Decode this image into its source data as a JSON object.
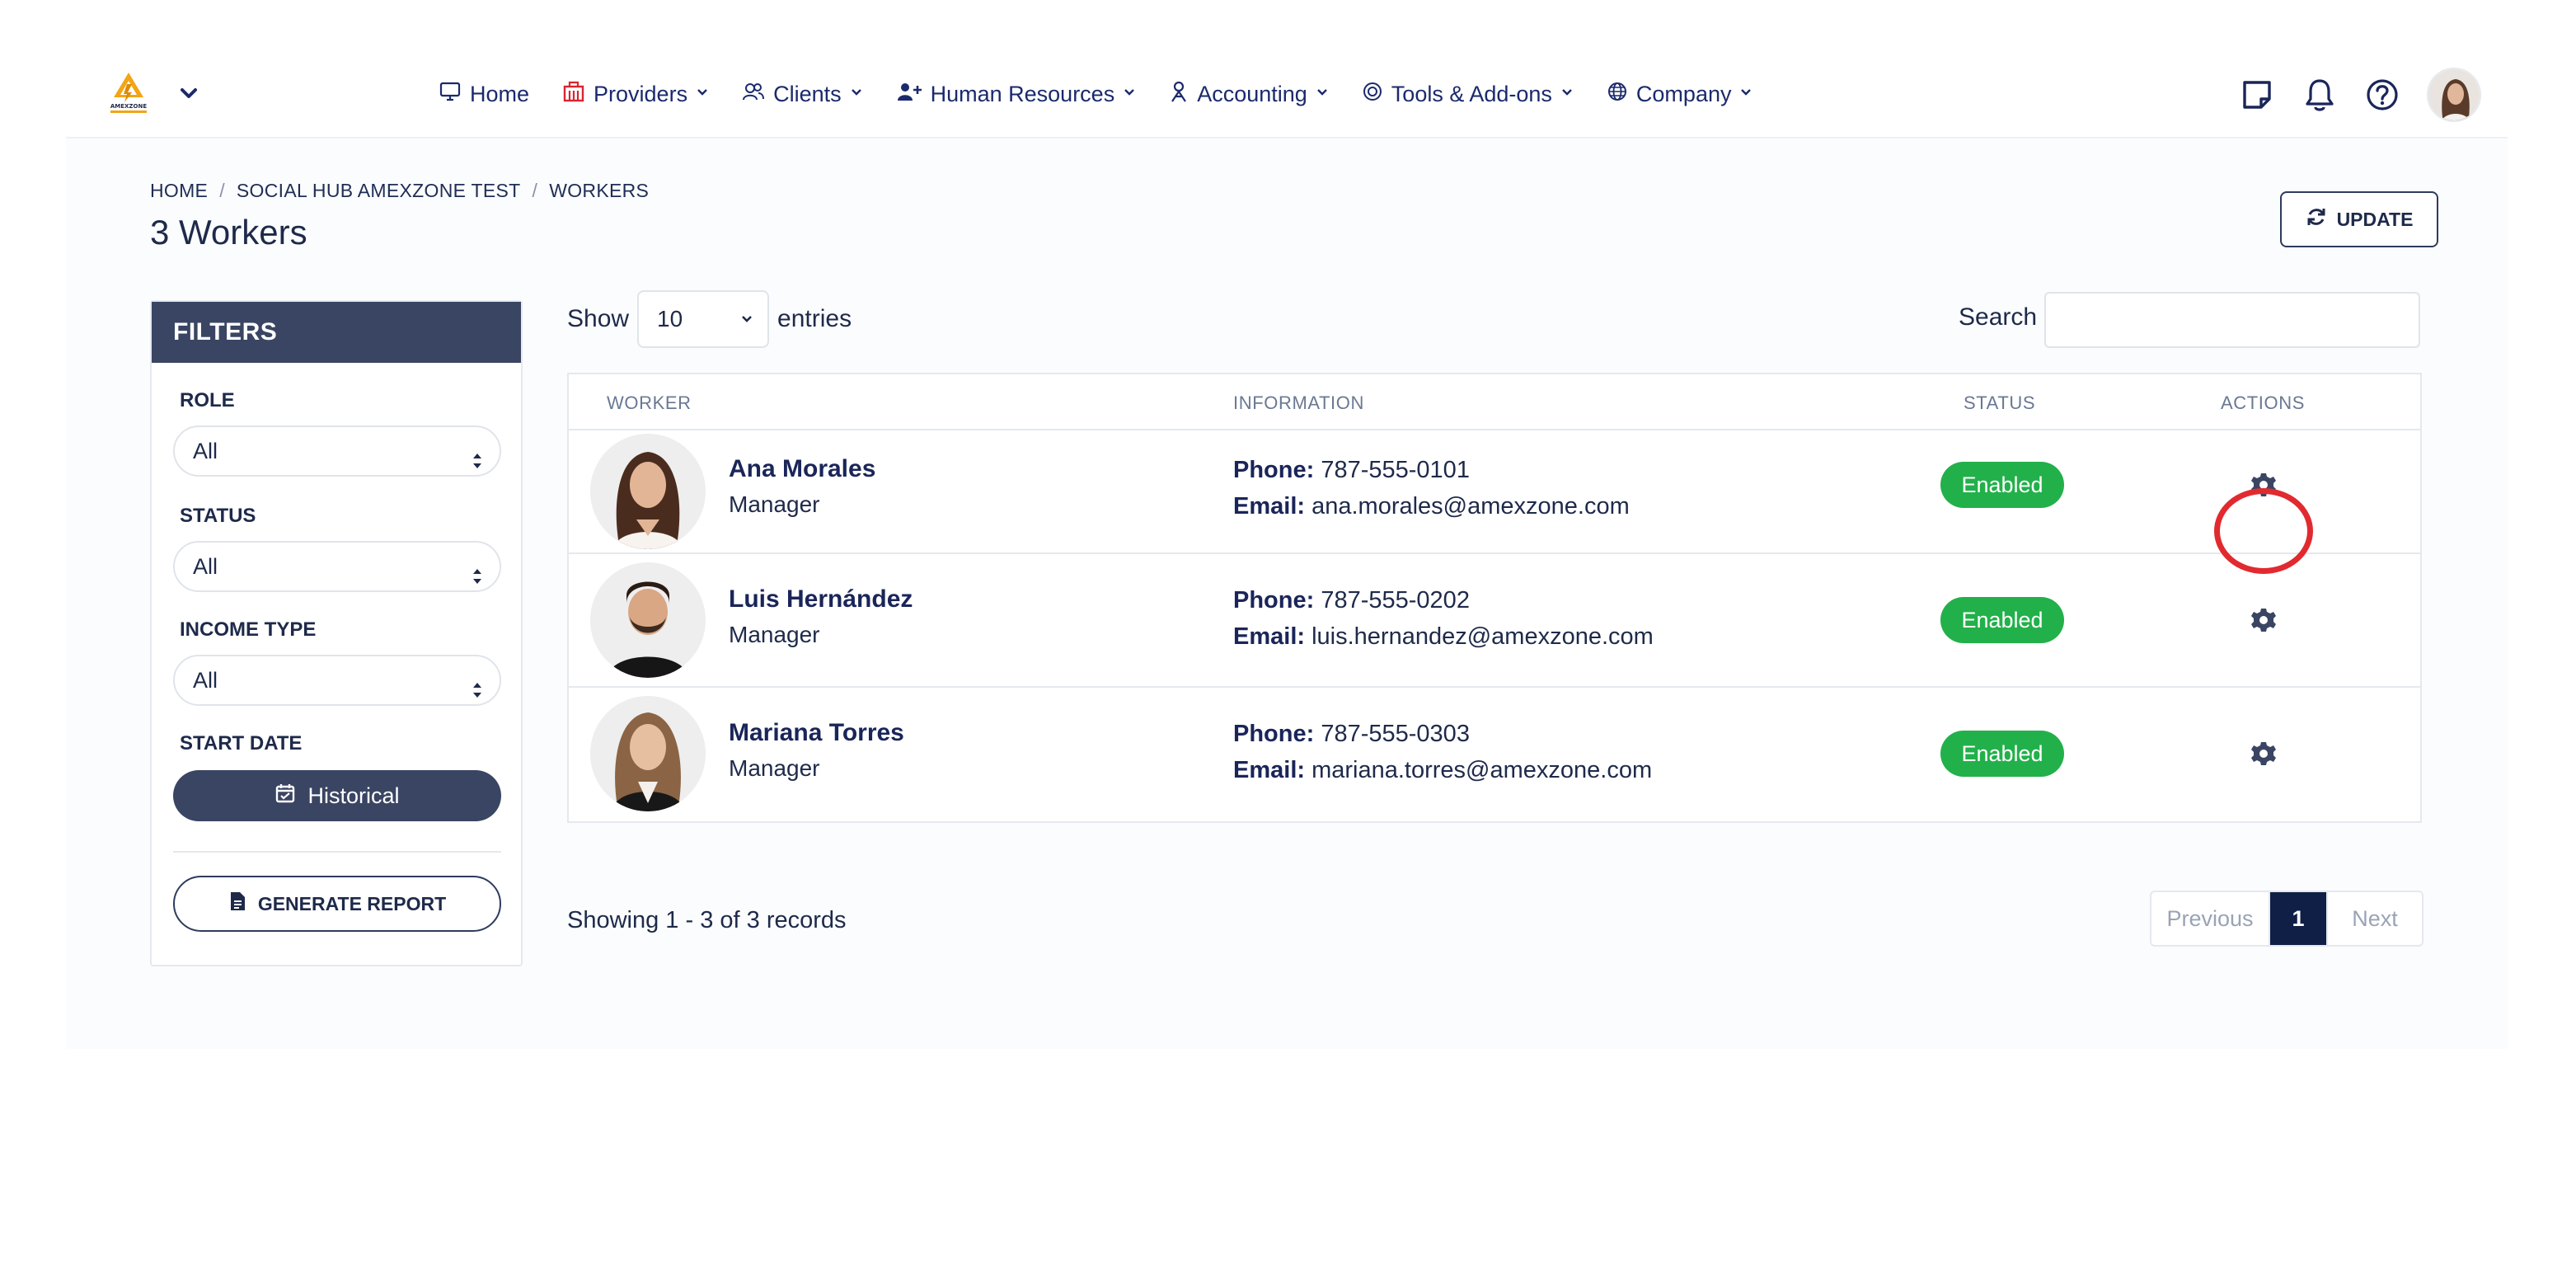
{
  "nav": {
    "logo_text": "AMEXZONE",
    "items": [
      {
        "label": "Home",
        "icon": "monitor-icon",
        "has_caret": false
      },
      {
        "label": "Providers",
        "icon": "building-icon",
        "has_caret": true
      },
      {
        "label": "Clients",
        "icon": "users-icon",
        "has_caret": true
      },
      {
        "label": "Human Resources",
        "icon": "user-plus-icon",
        "has_caret": true
      },
      {
        "label": "Accounting",
        "icon": "accounting-icon",
        "has_caret": true
      },
      {
        "label": "Tools & Add-ons",
        "icon": "target-icon",
        "has_caret": true
      },
      {
        "label": "Company",
        "icon": "globe-icon",
        "has_caret": true
      }
    ],
    "right_icons": [
      "note-icon",
      "bell-icon",
      "help-icon",
      "user-avatar"
    ]
  },
  "breadcrumb": [
    "HOME",
    "SOCIAL HUB AMEXZONE TEST",
    "WORKERS"
  ],
  "breadcrumb_sep": "/",
  "page_title": "3 Workers",
  "update_label": "UPDATE",
  "filters": {
    "title": "FILTERS",
    "role_label": "ROLE",
    "role_value": "All",
    "status_label": "STATUS",
    "status_value": "All",
    "income_label": "INCOME TYPE",
    "income_value": "All",
    "start_date_label": "START DATE",
    "historical_label": "Historical",
    "report_label": "GENERATE REPORT"
  },
  "table_controls": {
    "show_label": "Show",
    "entries_value": "10",
    "entries_label": "entries",
    "search_label": "Search",
    "search_value": ""
  },
  "table": {
    "headers": {
      "worker": "WORKER",
      "information": "INFORMATION",
      "status": "STATUS",
      "actions": "ACTIONS"
    },
    "phone_label": "Phone:",
    "email_label": "Email:",
    "rows": [
      {
        "name": "Ana Morales",
        "role": "Manager",
        "phone": "787-555-0101",
        "email": "ana.morales@amexzone.com",
        "status": "Enabled",
        "highlighted": true
      },
      {
        "name": "Luis Hernández",
        "role": "Manager",
        "phone": "787-555-0202",
        "email": "luis.hernandez@amexzone.com",
        "status": "Enabled",
        "highlighted": false
      },
      {
        "name": "Mariana Torres",
        "role": "Manager",
        "phone": "787-555-0303",
        "email": "mariana.torres@amexzone.com",
        "status": "Enabled",
        "highlighted": false
      }
    ]
  },
  "footer": {
    "showing": "Showing 1 - 3 of 3 records",
    "prev_label": "Previous",
    "current_page": "1",
    "next_label": "Next"
  },
  "colors": {
    "accent_dark": "#3a4563",
    "nav_text": "#1a2a6c",
    "enabled_badge": "#22b04a",
    "highlight_ring": "#e12a2f",
    "pager_current": "#0f1f45"
  }
}
